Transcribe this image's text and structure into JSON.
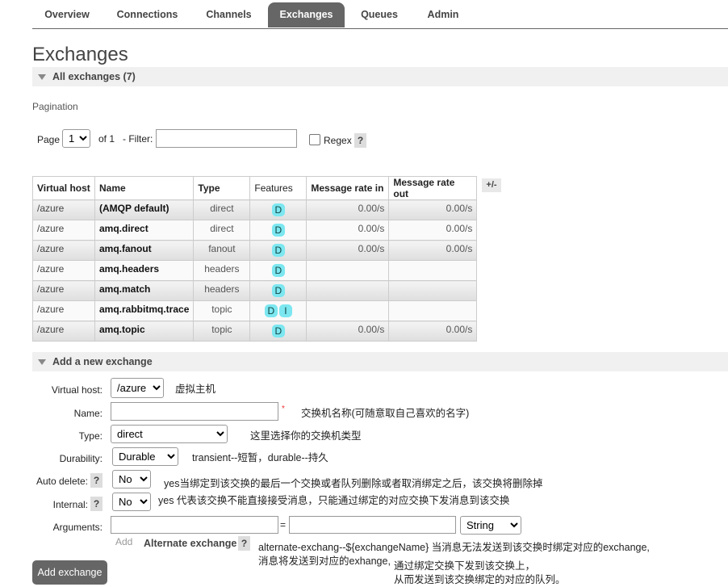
{
  "nav": {
    "tabs": [
      "Overview",
      "Connections",
      "Channels",
      "Exchanges",
      "Queues",
      "Admin"
    ],
    "active": "Exchanges"
  },
  "page": {
    "title": "Exchanges",
    "all_section": "All exchanges (7)",
    "pagination_label": "Pagination"
  },
  "pagination": {
    "page_label": "Page",
    "page_value": "1",
    "of_text": "of 1",
    "filter_label": "- Filter:",
    "filter_value": "",
    "regex_label": "Regex",
    "help": "?"
  },
  "table": {
    "columns": [
      "Virtual host",
      "Name",
      "Type",
      "Features",
      "Message rate in",
      "Message rate out"
    ],
    "toggle": "+/-",
    "rows": [
      {
        "vhost": "/azure",
        "name": "(AMQP default)",
        "type": "direct",
        "features": [
          "D"
        ],
        "rate_in": "0.00/s",
        "rate_out": "0.00/s"
      },
      {
        "vhost": "/azure",
        "name": "amq.direct",
        "type": "direct",
        "features": [
          "D"
        ],
        "rate_in": "0.00/s",
        "rate_out": "0.00/s"
      },
      {
        "vhost": "/azure",
        "name": "amq.fanout",
        "type": "fanout",
        "features": [
          "D"
        ],
        "rate_in": "0.00/s",
        "rate_out": "0.00/s"
      },
      {
        "vhost": "/azure",
        "name": "amq.headers",
        "type": "headers",
        "features": [
          "D"
        ],
        "rate_in": "",
        "rate_out": ""
      },
      {
        "vhost": "/azure",
        "name": "amq.match",
        "type": "headers",
        "features": [
          "D"
        ],
        "rate_in": "",
        "rate_out": ""
      },
      {
        "vhost": "/azure",
        "name": "amq.rabbitmq.trace",
        "type": "topic",
        "features": [
          "D",
          "I"
        ],
        "rate_in": "",
        "rate_out": ""
      },
      {
        "vhost": "/azure",
        "name": "amq.topic",
        "type": "topic",
        "features": [
          "D"
        ],
        "rate_in": "0.00/s",
        "rate_out": "0.00/s"
      }
    ]
  },
  "add_exchange": {
    "section": "Add a new exchange",
    "vhost_label": "Virtual host:",
    "vhost_value": "/azure",
    "vhost_note": "虚拟主机",
    "name_label": "Name:",
    "name_value": "",
    "name_required": "*",
    "name_note": "交换机名称(可随意取自己喜欢的名字)",
    "type_label": "Type:",
    "type_value": "direct",
    "type_note": "这里选择你的交换机类型",
    "durability_label": "Durability:",
    "durability_value": "Durable",
    "durability_note": "transient--短暂，durable--持久",
    "auto_delete_label": "Auto delete:",
    "auto_delete_value": "No",
    "auto_delete_note": "yes当绑定到该交换的最后一个交换或者队列删除或者取消绑定之后，该交换将删除掉",
    "internal_label": "Internal:",
    "internal_value": "No",
    "internal_note": "yes 代表该交换不能直接接受消息，只能通过绑定的对应交换下发消息到该交换",
    "arguments_label": "Arguments:",
    "arg_key": "",
    "arg_eq": "=",
    "arg_value": "",
    "arg_type": "String",
    "add_link": "Add",
    "alternate_label": "Alternate exchange",
    "alternate_note_line1": "alternate-exchang--${exchangeName} 当消息无法发送到该交换时绑定对应的exchange,",
    "alternate_note_line2": "消息将发送到对应的exhange,",
    "alternate_note_line3": "通过绑定交换下发到该交换上，",
    "alternate_note_line4": "从而发送到该交换绑定的对应的队列。",
    "submit": "Add exchange",
    "help": "?"
  }
}
